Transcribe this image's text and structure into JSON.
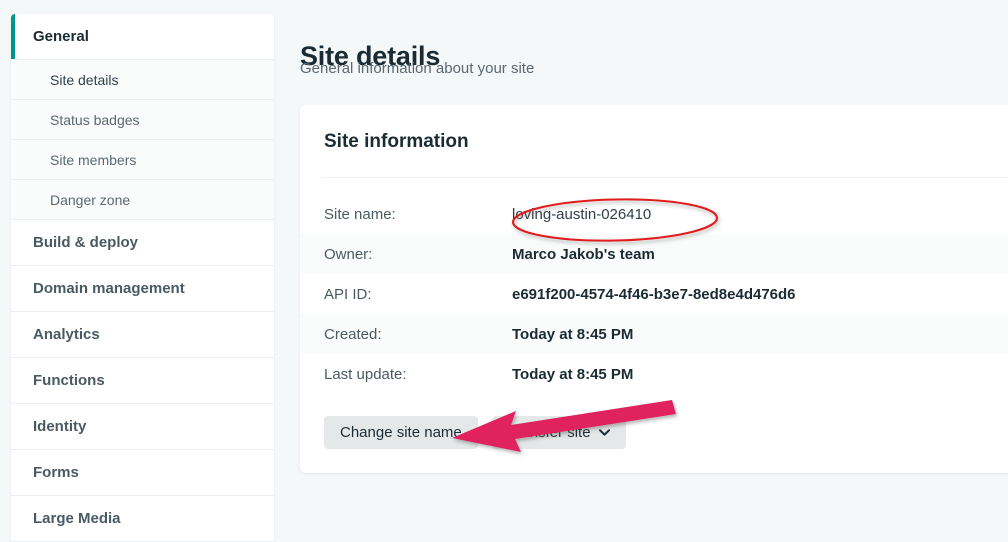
{
  "sidebar": {
    "items": [
      {
        "label": "General",
        "type": "group",
        "active": true
      },
      {
        "label": "Site details",
        "type": "sub",
        "current": true
      },
      {
        "label": "Status badges",
        "type": "sub",
        "current": false
      },
      {
        "label": "Site members",
        "type": "sub",
        "current": false
      },
      {
        "label": "Danger zone",
        "type": "sub",
        "current": false
      },
      {
        "label": "Build & deploy",
        "type": "group",
        "active": false
      },
      {
        "label": "Domain management",
        "type": "group",
        "active": false
      },
      {
        "label": "Analytics",
        "type": "group",
        "active": false
      },
      {
        "label": "Functions",
        "type": "group",
        "active": false
      },
      {
        "label": "Identity",
        "type": "group",
        "active": false
      },
      {
        "label": "Forms",
        "type": "group",
        "active": false
      },
      {
        "label": "Large Media",
        "type": "group",
        "active": false
      }
    ]
  },
  "header": {
    "title": "Site details",
    "subtitle": "General information about your site"
  },
  "card": {
    "title": "Site information",
    "rows": [
      {
        "label": "Site name:",
        "value": "loving-austin-026410",
        "emphasis": "normal"
      },
      {
        "label": "Owner:",
        "value": "Marco Jakob's team",
        "emphasis": "bold"
      },
      {
        "label": "API ID:",
        "value": "e691f200-4574-4f46-b3e7-8ed8e4d476d6",
        "emphasis": "bold"
      },
      {
        "label": "Created:",
        "value": "Today at 8:45 PM",
        "emphasis": "bold"
      },
      {
        "label": "Last update:",
        "value": "Today at 8:45 PM",
        "emphasis": "bold"
      }
    ],
    "actions": {
      "change_site_name_label": "Change site name",
      "transfer_site_label": "Transfer site",
      "transfer_site_icon": "chevron-down-icon",
      "chevron_glyph": "❯"
    }
  },
  "annotations": {
    "highlight_ellipse": {
      "target": "loving-austin-026410",
      "color": "#e01b1b",
      "shape": "ellipse"
    },
    "pointer_arrow": {
      "target": "Change site name",
      "color": "#e0245e",
      "shape": "arrow-left"
    }
  },
  "colors": {
    "accent_teal": "#00968e",
    "page_background": "#f5f8f9",
    "card_background": "#ffffff",
    "button_background": "#e5e8e8",
    "text_primary": "#1b2b34",
    "text_secondary": "#5a6872"
  }
}
